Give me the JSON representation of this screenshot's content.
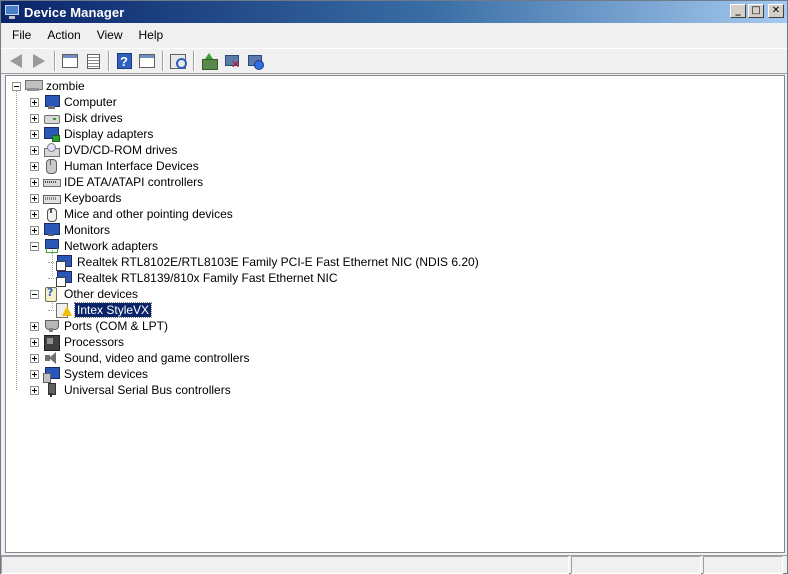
{
  "window": {
    "title": "Device Manager"
  },
  "menu": {
    "items": [
      "File",
      "Action",
      "View",
      "Help"
    ]
  },
  "toolbar": {
    "buttons": [
      "back-icon",
      "forward-icon",
      "show-hide-console-tree-icon",
      "properties-icon",
      "help-icon",
      "show-hide-action-pane-icon",
      "scan-hardware-icon",
      "update-driver-icon",
      "disable-icon",
      "uninstall-icon"
    ]
  },
  "tree": {
    "root": "zombie",
    "categories": [
      {
        "label": "Computer",
        "expanded": false
      },
      {
        "label": "Disk drives",
        "expanded": false
      },
      {
        "label": "Display adapters",
        "expanded": false
      },
      {
        "label": "DVD/CD-ROM drives",
        "expanded": false
      },
      {
        "label": "Human Interface Devices",
        "expanded": false
      },
      {
        "label": "IDE ATA/ATAPI controllers",
        "expanded": false
      },
      {
        "label": "Keyboards",
        "expanded": false
      },
      {
        "label": "Mice and other pointing devices",
        "expanded": false
      },
      {
        "label": "Monitors",
        "expanded": false
      },
      {
        "label": "Network adapters",
        "expanded": true,
        "children": [
          "Realtek RTL8102E/RTL8103E Family PCI-E Fast Ethernet NIC (NDIS 6.20)",
          "Realtek RTL8139/810x Family Fast Ethernet NIC"
        ]
      },
      {
        "label": "Other devices",
        "expanded": true,
        "children": [
          "Intex StyleVX"
        ]
      },
      {
        "label": "Ports (COM & LPT)",
        "expanded": false
      },
      {
        "label": "Processors",
        "expanded": false
      },
      {
        "label": "Sound, video and game controllers",
        "expanded": false
      },
      {
        "label": "System devices",
        "expanded": false
      },
      {
        "label": "Universal Serial Bus controllers",
        "expanded": false
      }
    ],
    "selected": "Intex StyleVX"
  },
  "colors": {
    "titlebar": "#0a246a",
    "selection": "#0a246a"
  }
}
